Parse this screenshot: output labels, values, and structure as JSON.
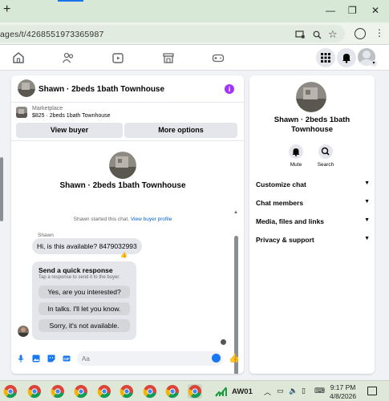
{
  "browser": {
    "new_tab": "+",
    "url": "ages/t/4268551973365987",
    "minimize": "—",
    "restore": "❐",
    "close": "✕",
    "menu": "⋮"
  },
  "chat": {
    "title": "Shawn · 2beds 1bath Townhouse",
    "marketplace_label": "Marketplace",
    "listing_price": "$825 · 2beds 1bath Townhouse",
    "view_buyer": "View buyer",
    "more_options": "More options",
    "convo_name": "Shawn · 2beds 1bath Townhouse",
    "started_text": "Shawn started this chat.",
    "view_profile": "View buyer profile",
    "sender": "Shawn",
    "message": "Hi, is this available? 8479032993",
    "quick_title": "Send a quick response",
    "quick_sub": "Tap a response to send it to the buyer.",
    "quick_responses": [
      "Yes, are you interested?",
      "In talks. I'll let you know.",
      "Sorry, it's not available."
    ],
    "input_placeholder": "Aa"
  },
  "side": {
    "name": "Shawn · 2beds 1bath Townhouse",
    "mute": "Mute",
    "search": "Search",
    "sections": [
      "Customize chat",
      "Chat members",
      "Media, files and links",
      "Privacy & support"
    ]
  },
  "taskbar": {
    "app_label": "AW01",
    "time": "9:17 PM",
    "date": "4/8/2026"
  },
  "colors": {
    "accent": "#1877f2",
    "info": "#a033ff",
    "link": "#0064d1"
  }
}
